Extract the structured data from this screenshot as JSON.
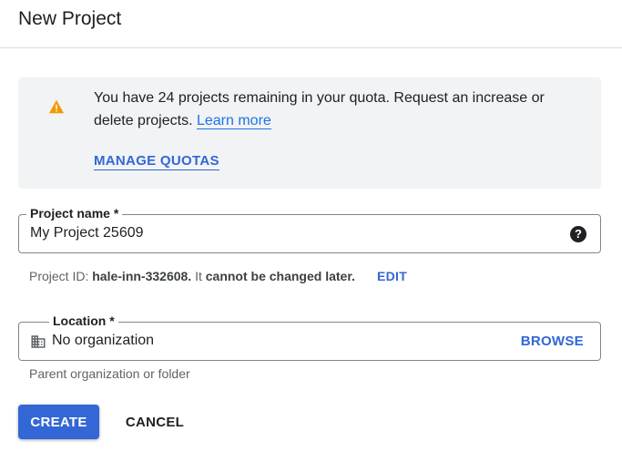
{
  "page": {
    "title": "New Project"
  },
  "quota": {
    "message": "You have 24 projects remaining in your quota. Request an increase or delete projects.",
    "learn_more": "Learn more",
    "manage_label": "MANAGE QUOTAS",
    "icon": "warning-icon"
  },
  "project_name": {
    "label": "Project name *",
    "value": "My Project 25609",
    "help_icon": "help-icon"
  },
  "project_id": {
    "prefix": "Project ID: ",
    "id": "hale-inn-332608.",
    "middle": " It ",
    "emphasis": "cannot be changed later.",
    "edit_label": "EDIT"
  },
  "location": {
    "label": "Location *",
    "value": "No organization",
    "browse_label": "BROWSE",
    "helper": "Parent organization or folder",
    "icon": "building-icon"
  },
  "actions": {
    "create_label": "CREATE",
    "cancel_label": "CANCEL"
  },
  "colors": {
    "accent": "#3367d6",
    "warning": "#f29900",
    "info_bg": "#f1f3f4"
  }
}
